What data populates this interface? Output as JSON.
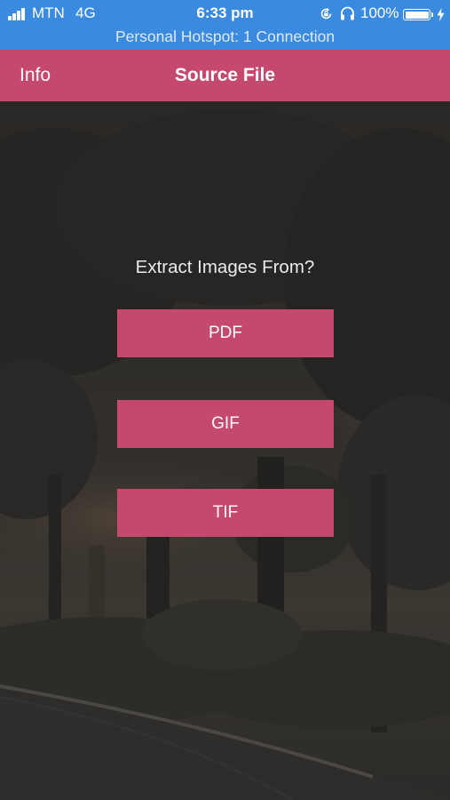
{
  "status_bar": {
    "carrier": "MTN",
    "network": "4G",
    "time": "6:33 pm",
    "battery_percent": "100%",
    "hotspot_text": "Personal Hotspot: 1 Connection",
    "icons": [
      "signal-icon",
      "rotation-lock-icon",
      "headphones-icon",
      "battery-icon",
      "charging-icon"
    ]
  },
  "nav": {
    "left_label": "Info",
    "title": "Source File"
  },
  "main": {
    "prompt": "Extract Images From?",
    "options": [
      "PDF",
      "GIF",
      "TIF"
    ]
  },
  "colors": {
    "status_bar_bg": "#3a8ae0",
    "accent": "#c5486f",
    "background": "#2b2a28"
  }
}
